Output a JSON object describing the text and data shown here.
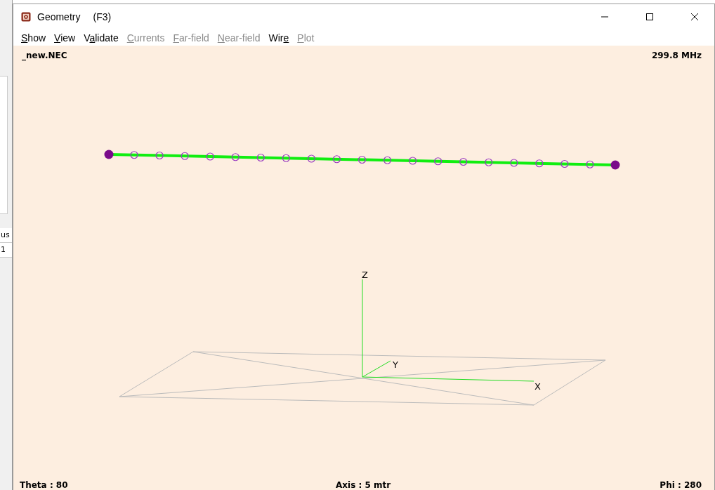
{
  "background_window": {
    "cells": [
      "us",
      "1"
    ]
  },
  "window": {
    "title": "Geometry",
    "shortcut": "(F3)"
  },
  "menu": [
    {
      "segments": [
        {
          "text": "S",
          "underlined": true
        },
        {
          "text": "how",
          "underlined": false
        }
      ],
      "disabled": false
    },
    {
      "segments": [
        {
          "text": "V",
          "underlined": true
        },
        {
          "text": "iew",
          "underlined": false
        }
      ],
      "disabled": false
    },
    {
      "segments": [
        {
          "text": "V",
          "underlined": false
        },
        {
          "text": "a",
          "underlined": true
        },
        {
          "text": "lidate",
          "underlined": false
        }
      ],
      "disabled": false
    },
    {
      "segments": [
        {
          "text": "C",
          "underlined": true
        },
        {
          "text": "urrents",
          "underlined": false
        }
      ],
      "disabled": true
    },
    {
      "segments": [
        {
          "text": "F",
          "underlined": true
        },
        {
          "text": "ar-field",
          "underlined": false
        }
      ],
      "disabled": true
    },
    {
      "segments": [
        {
          "text": "N",
          "underlined": true
        },
        {
          "text": "ear-field",
          "underlined": false
        }
      ],
      "disabled": true
    },
    {
      "segments": [
        {
          "text": "Wir",
          "underlined": false
        },
        {
          "text": "e",
          "underlined": true
        }
      ],
      "disabled": false
    },
    {
      "segments": [
        {
          "text": "P",
          "underlined": true
        },
        {
          "text": "lot",
          "underlined": false
        }
      ],
      "disabled": true
    }
  ],
  "canvas": {
    "file": "_new.NEC",
    "frequency": "299.8 MHz",
    "axes": {
      "z": "Z",
      "y": "Y",
      "x": "X"
    },
    "theta": "Theta : 80",
    "axis_scale": "Axis : 5 mtr",
    "phi": "Phi : 280"
  }
}
